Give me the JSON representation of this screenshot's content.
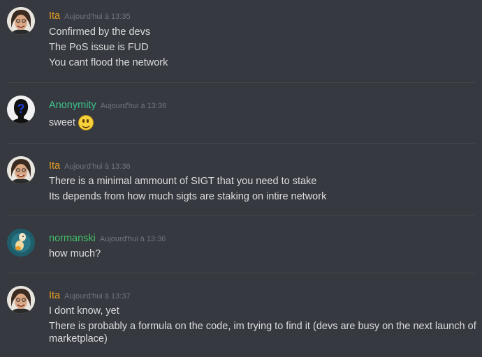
{
  "colors": {
    "background": "#36393f",
    "ita": "#e59b22",
    "anonymity": "#3cc48a",
    "normanski": "#43c16a",
    "timestamp": "#72767d"
  },
  "messages": [
    {
      "author": "Ita",
      "timestamp": "Aujourd'hui à 13:35",
      "avatar": "ita-avatar",
      "lines": [
        "Confirmed by the devs",
        "The PoS issue is FUD",
        "You cant flood the network"
      ]
    },
    {
      "author": "Anonymity",
      "timestamp": "Aujourd'hui à 13:36",
      "avatar": "anonymity-avatar",
      "lines": [
        "sweet"
      ],
      "emoji": "smiley-emoji"
    },
    {
      "author": "Ita",
      "timestamp": "Aujourd'hui à 13:36",
      "avatar": "ita-avatar",
      "lines": [
        "There is a minimal ammount of SIGT that you need to stake",
        "Its depends from how much sigts are staking on intire network"
      ]
    },
    {
      "author": "normanski",
      "timestamp": "Aujourd'hui à 13:36",
      "avatar": "normanski-avatar",
      "lines": [
        "how much?"
      ]
    },
    {
      "author": "Ita",
      "timestamp": "Aujourd'hui à 13:37",
      "avatar": "ita-avatar",
      "lines": [
        "I dont know, yet",
        "There is probably a formula on the code, im trying to find it (devs are busy on the next launch of",
        "marketplace)"
      ]
    }
  ]
}
